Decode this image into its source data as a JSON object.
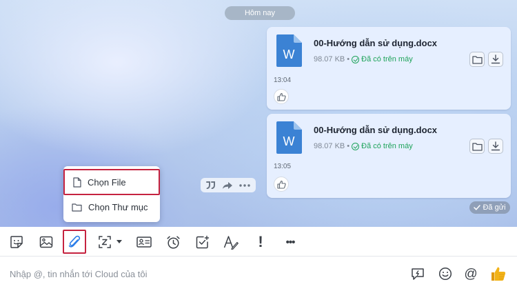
{
  "chat": {
    "date_label": "Hôm nay",
    "messages": [
      {
        "file_name": "00-Hướng dẫn sử dụng.docx",
        "file_size": "98.07 KB",
        "separator": "•",
        "status": "Đã có trên máy",
        "time": "13:04",
        "icon_letter": "W"
      },
      {
        "file_name": "00-Hướng dẫn sử dụng.docx",
        "file_size": "98.07 KB",
        "separator": "•",
        "status": "Đã có trên máy",
        "time": "13:05",
        "icon_letter": "W"
      }
    ],
    "sent_label": "Đã gửi"
  },
  "attach_menu": {
    "choose_file": "Chọn File",
    "choose_folder": "Chọn Thư mục"
  },
  "toolbar": {
    "icons": [
      "sticker-icon",
      "image-icon",
      "paperclip-icon",
      "screenshot-icon",
      "contact-card-icon",
      "alarm-clock-icon",
      "task-icon",
      "text-format-icon",
      "important-icon",
      "more-icon"
    ],
    "important_glyph": "!",
    "more_glyph": "•••"
  },
  "input": {
    "placeholder": "Nhập @, tin nhắn tới Cloud của tôi",
    "at_glyph": "@"
  },
  "colors": {
    "accent_blue": "#2b7de9",
    "word_blue": "#3b82d4",
    "status_green": "#1ea35a",
    "highlight_red": "#c5223f",
    "thumb_yellow": "#f2b318"
  }
}
